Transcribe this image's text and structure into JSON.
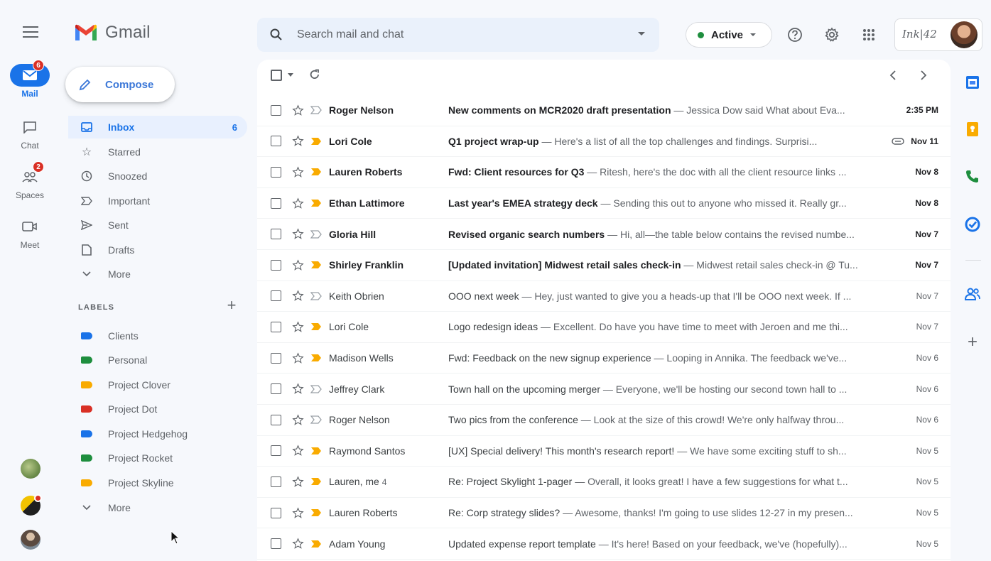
{
  "app": {
    "name": "Gmail"
  },
  "rail": {
    "items": [
      {
        "id": "mail",
        "label": "Mail",
        "badge": "6",
        "icon": "mail-icon",
        "active": true
      },
      {
        "id": "chat",
        "label": "Chat",
        "icon": "chat-icon"
      },
      {
        "id": "spaces",
        "label": "Spaces",
        "badge": "2",
        "icon": "spaces-icon"
      },
      {
        "id": "meet",
        "label": "Meet",
        "icon": "meet-icon"
      }
    ]
  },
  "compose": {
    "label": "Compose"
  },
  "nav": {
    "items": [
      {
        "label": "Inbox",
        "count": "6",
        "icon": "inbox-icon",
        "active": true
      },
      {
        "label": "Starred",
        "icon": "star-icon"
      },
      {
        "label": "Snoozed",
        "icon": "clock-icon"
      },
      {
        "label": "Important",
        "icon": "important-icon"
      },
      {
        "label": "Sent",
        "icon": "send-icon"
      },
      {
        "label": "Drafts",
        "icon": "draft-icon"
      },
      {
        "label": "More",
        "icon": "chevron-down-icon"
      }
    ]
  },
  "labels": {
    "heading": "LABELS",
    "items": [
      {
        "label": "Clients",
        "color": "#1a73e8"
      },
      {
        "label": "Personal",
        "color": "#1e8e3e"
      },
      {
        "label": "Project Clover",
        "color": "#f9ab00"
      },
      {
        "label": "Project Dot",
        "color": "#d93025"
      },
      {
        "label": "Project Hedgehog",
        "color": "#1a73e8"
      },
      {
        "label": "Project Rocket",
        "color": "#1e8e3e"
      },
      {
        "label": "Project Skyline",
        "color": "#f9ab00"
      }
    ],
    "more": "More"
  },
  "search": {
    "placeholder": "Search mail and chat"
  },
  "status": {
    "label": "Active",
    "color": "#1e8e3e"
  },
  "brand": {
    "text": "Ink|42"
  },
  "emails": [
    {
      "sender": "Roger Nelson",
      "subject": "New comments on MCR2020 draft presentation",
      "snippet": " — Jessica Dow said What about Eva...",
      "date": "2:35 PM",
      "important": false,
      "read": false
    },
    {
      "sender": "Lori Cole",
      "subject": "Q1 project wrap-up",
      "snippet": " — Here's a list of all the top challenges and findings. Surprisi...",
      "date": "Nov 11",
      "important": true,
      "read": false,
      "attachment": true
    },
    {
      "sender": "Lauren Roberts",
      "subject": "Fwd: Client resources for Q3",
      "snippet": " — Ritesh, here's the doc with all the client resource links ...",
      "date": "Nov 8",
      "important": true,
      "read": false
    },
    {
      "sender": "Ethan Lattimore",
      "subject": "Last year's EMEA strategy deck",
      "snippet": " — Sending this out to anyone who missed it. Really gr...",
      "date": "Nov 8",
      "important": true,
      "read": false
    },
    {
      "sender": "Gloria Hill",
      "subject": "Revised organic search numbers",
      "snippet": " — Hi, all—the table below contains the revised numbe...",
      "date": "Nov 7",
      "important": false,
      "read": false
    },
    {
      "sender": "Shirley Franklin",
      "subject": "[Updated invitation] Midwest retail sales check-in",
      "snippet": " — Midwest retail sales check-in @ Tu...",
      "date": "Nov 7",
      "important": true,
      "read": false
    },
    {
      "sender": "Keith Obrien",
      "subject": "OOO next week",
      "snippet": " — Hey, just wanted to give you a heads-up that I'll be OOO next week. If ...",
      "date": "Nov 7",
      "important": false,
      "read": true
    },
    {
      "sender": "Lori Cole",
      "subject": "Logo redesign ideas",
      "snippet": " — Excellent. Do have you have time to meet with Jeroen and me thi...",
      "date": "Nov 7",
      "important": true,
      "read": true
    },
    {
      "sender": "Madison Wells",
      "subject": "Fwd: Feedback on the new signup experience",
      "snippet": " — Looping in Annika. The feedback we've...",
      "date": "Nov 6",
      "important": true,
      "read": true
    },
    {
      "sender": "Jeffrey Clark",
      "subject": "Town hall on the upcoming merger",
      "snippet": " — Everyone, we'll be hosting our second town hall to ...",
      "date": "Nov 6",
      "important": false,
      "read": true
    },
    {
      "sender": "Roger Nelson",
      "subject": "Two pics from the conference",
      "snippet": " — Look at the size of this crowd! We're only halfway throu...",
      "date": "Nov 6",
      "important": false,
      "read": true
    },
    {
      "sender": "Raymond Santos",
      "subject": "[UX] Special delivery! This month's research report!",
      "snippet": " — We have some exciting stuff to sh...",
      "date": "Nov 5",
      "important": true,
      "read": true
    },
    {
      "sender": "Lauren, me",
      "count": "4",
      "subject": "Re: Project Skylight 1-pager",
      "snippet": " — Overall, it looks great! I have a few suggestions for what t...",
      "date": "Nov 5",
      "important": true,
      "read": true
    },
    {
      "sender": "Lauren Roberts",
      "subject": "Re: Corp strategy slides?",
      "snippet": " — Awesome, thanks! I'm going to use slides 12-27 in my presen...",
      "date": "Nov 5",
      "important": true,
      "read": true
    },
    {
      "sender": "Adam Young",
      "subject": "Updated expense report template",
      "snippet": " — It's here! Based on your feedback, we've (hopefully)...",
      "date": "Nov 5",
      "important": true,
      "read": true
    }
  ],
  "side_panel": [
    {
      "icon": "calendar-icon",
      "color": "#1a73e8"
    },
    {
      "icon": "keep-icon",
      "color": "#f9ab00"
    },
    {
      "icon": "voice-icon",
      "color": "#1e8e3e"
    },
    {
      "icon": "tasks-icon",
      "color": "#1a73e8"
    },
    {
      "icon": "contacts-icon",
      "color": "#1a73e8"
    },
    {
      "icon": "add-icon",
      "color": "#5f6368"
    }
  ]
}
